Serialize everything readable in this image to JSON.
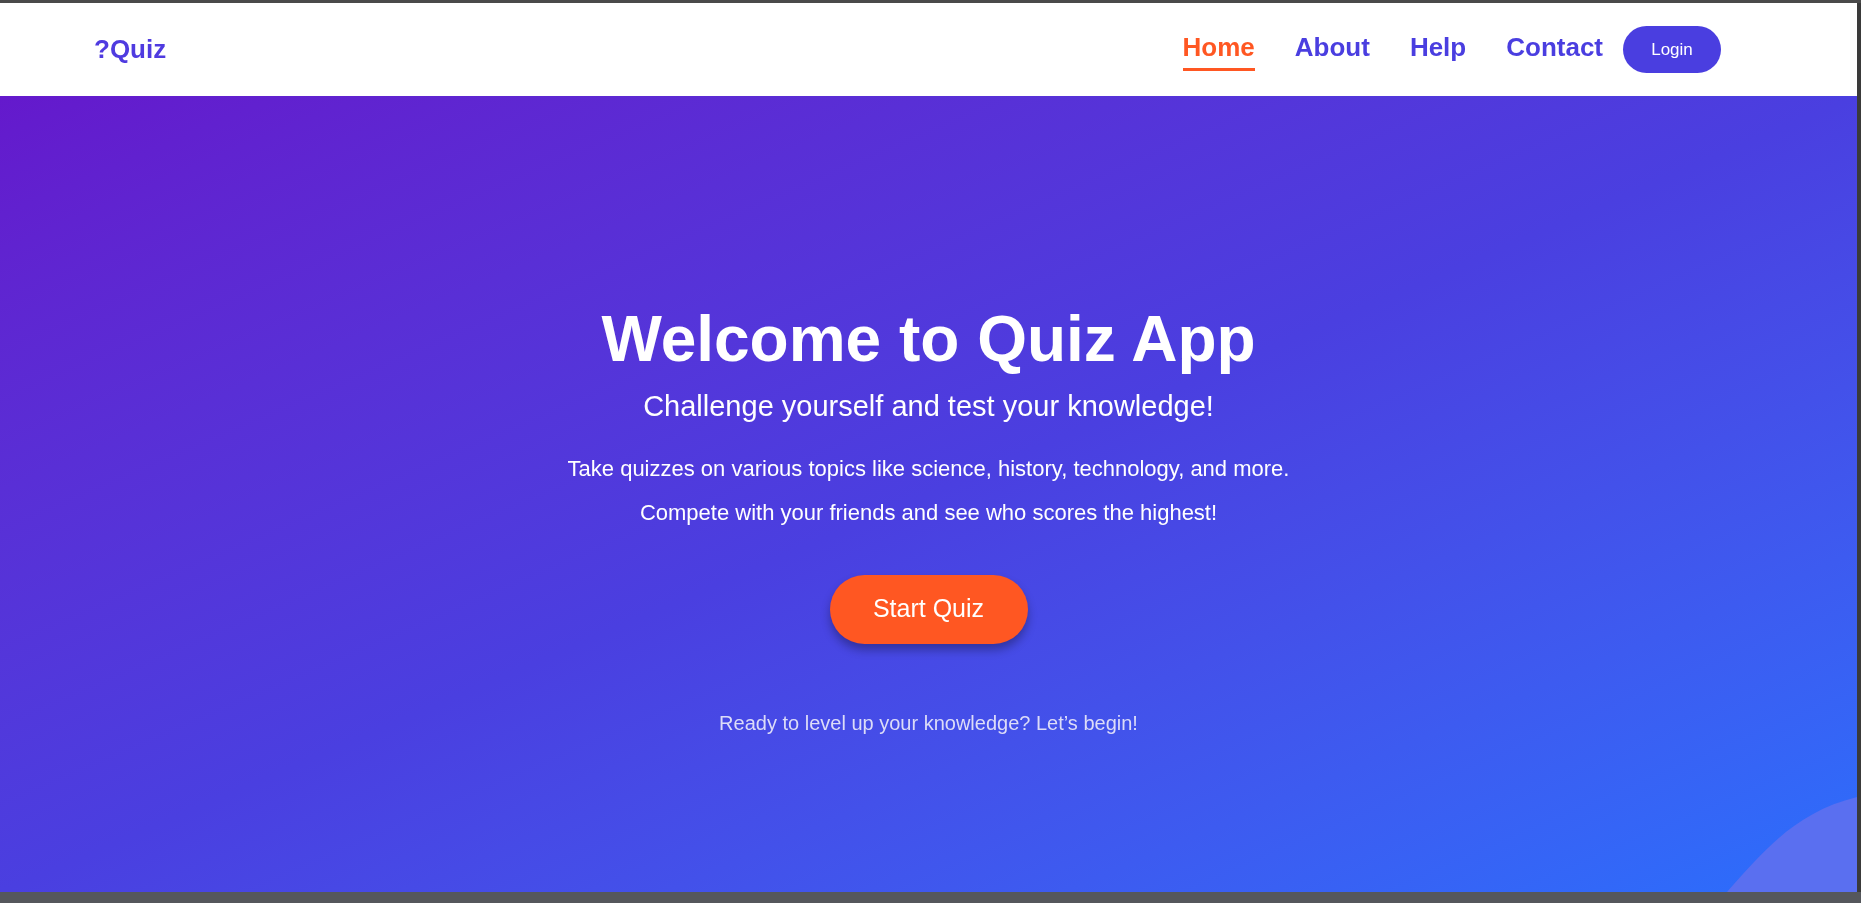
{
  "header": {
    "logo": "?Quiz",
    "nav": [
      {
        "label": "Home",
        "selected": true
      },
      {
        "label": "About",
        "selected": false
      },
      {
        "label": "Help",
        "selected": false
      },
      {
        "label": "Contact",
        "selected": false
      }
    ],
    "login": "Login"
  },
  "hero": {
    "title": "Welcome to Quiz App",
    "subtitle": "Challenge yourself and test your knowledge!",
    "description": "Take quizzes on various topics like science, history, technology, and more. Compete with your friends and see who scores the highest!",
    "button": "Start Quiz",
    "footnote": "Ready to level up your knowledge? Let’s begin!"
  }
}
